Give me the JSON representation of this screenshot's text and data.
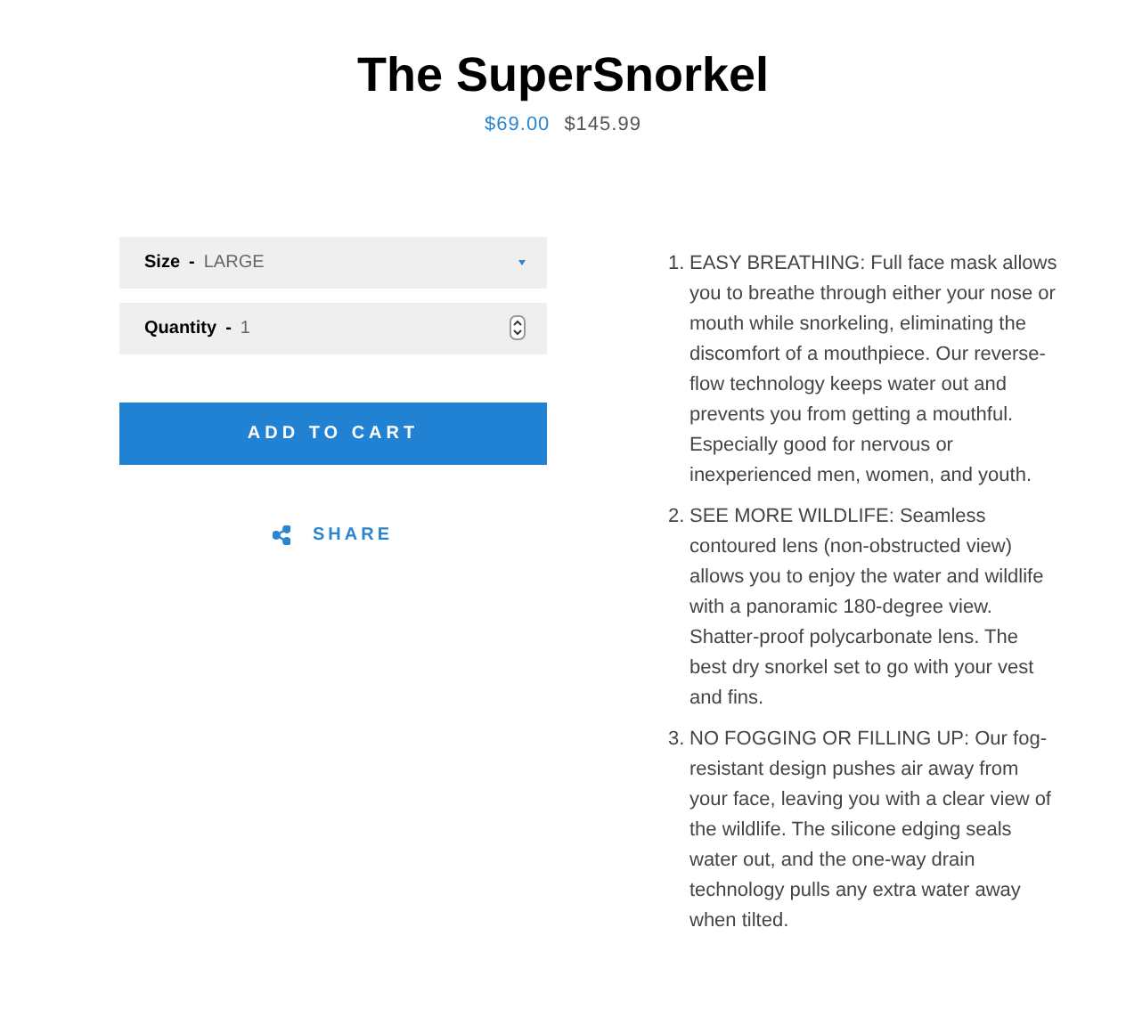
{
  "product": {
    "title": "The SuperSnorkel",
    "sale_price": "$69.00",
    "regular_price": "$145.99"
  },
  "options": [
    {
      "kind": "select",
      "label": "Size",
      "separator": "-",
      "value": "LARGE"
    },
    {
      "kind": "number",
      "label": "Quantity",
      "separator": "-",
      "value": "1"
    }
  ],
  "add_to_cart": "ADD TO CART",
  "share": "SHARE",
  "features": [
    {
      "number": "1.",
      "text": "EASY BREATHING: Full face mask allows you to breathe through either your nose or mouth while snorkeling, eliminating the discomfort of a mouthpiece. Our reverse-flow technology keeps water out and prevents you from getting a mouthful. Especially good for nervous or inexperienced men, women, and youth."
    },
    {
      "number": "2.",
      "text": "SEE MORE WILDLIFE: Seamless contoured lens (non-obstructed view) allows you to enjoy the water and wildlife with a panoramic 180-degree view. Shatter-proof polycarbonate lens. The best dry snorkel set to go with your vest and fins."
    },
    {
      "number": "3.",
      "text": "NO FOGGING OR FILLING UP: Our fog-resistant design pushes air away from your face, leaving you with a clear view of the wildlife. The silicone edging seals water out, and the one-way drain technology pulls any extra water away when tilted."
    }
  ]
}
